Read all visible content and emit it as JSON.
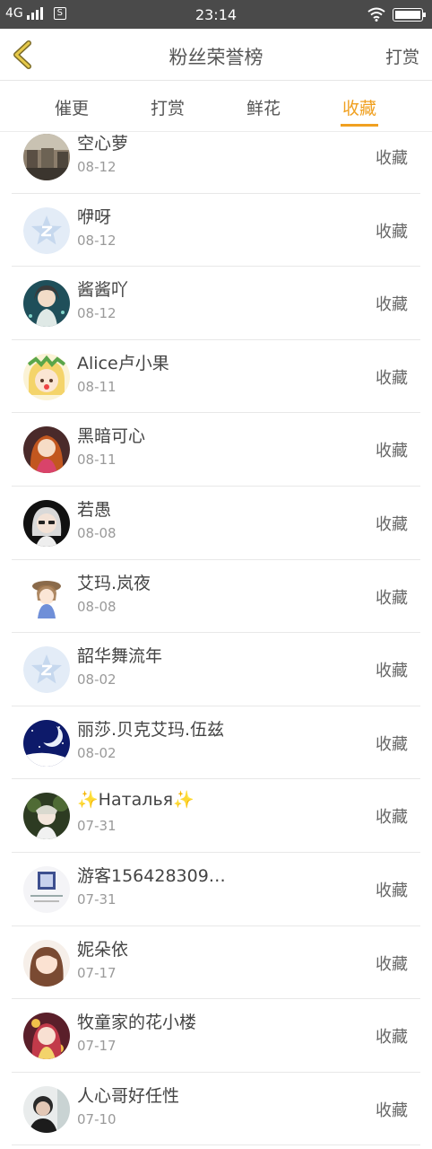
{
  "status_bar": {
    "network": "4G",
    "sim": "S",
    "time": "23:14"
  },
  "nav": {
    "title": "粉丝荣誉榜",
    "right_label": "打赏"
  },
  "tabs": [
    {
      "label": "催更"
    },
    {
      "label": "打赏"
    },
    {
      "label": "鲜花"
    },
    {
      "label": "收藏"
    }
  ],
  "active_tab": "收藏",
  "rows": [
    {
      "name": "空心萝",
      "date": "08-12",
      "action": "收藏",
      "avatar": "photo-street"
    },
    {
      "name": "咿呀",
      "date": "08-12",
      "action": "收藏",
      "avatar": "default-z"
    },
    {
      "name": "酱酱吖",
      "date": "08-12",
      "action": "收藏",
      "avatar": "anime-teal"
    },
    {
      "name": "Alice卢小果",
      "date": "08-11",
      "action": "收藏",
      "avatar": "anime-blonde"
    },
    {
      "name": "黑暗可心",
      "date": "08-11",
      "action": "收藏",
      "avatar": "anime-redhair"
    },
    {
      "name": "若愚",
      "date": "08-08",
      "action": "收藏",
      "avatar": "anime-silver"
    },
    {
      "name": "艾玛.岚夜",
      "date": "08-08",
      "action": "收藏",
      "avatar": "anime-chibi"
    },
    {
      "name": "韶华舞流年",
      "date": "08-02",
      "action": "收藏",
      "avatar": "default-z"
    },
    {
      "name": "丽莎.贝克艾玛.伍兹",
      "date": "08-02",
      "action": "收藏",
      "avatar": "night-moon"
    },
    {
      "name": "✨Наталья✨",
      "date": "07-31",
      "action": "收藏",
      "avatar": "anime-forest"
    },
    {
      "name": "游客156428309…",
      "date": "07-31",
      "action": "收藏",
      "avatar": "photo-blue"
    },
    {
      "name": "妮朵依",
      "date": "07-17",
      "action": "收藏",
      "avatar": "anime-brown"
    },
    {
      "name": "牧童家的花小楼",
      "date": "07-17",
      "action": "收藏",
      "avatar": "anime-redhair"
    },
    {
      "name": "人心哥好任性",
      "date": "07-10",
      "action": "收藏",
      "avatar": "photo-dark"
    }
  ],
  "colors": {
    "accent": "#f0a020",
    "status_bar": "#4a4a4a",
    "text": "#444444",
    "muted": "#9a9a9a",
    "separator": "#e8e8e8"
  }
}
